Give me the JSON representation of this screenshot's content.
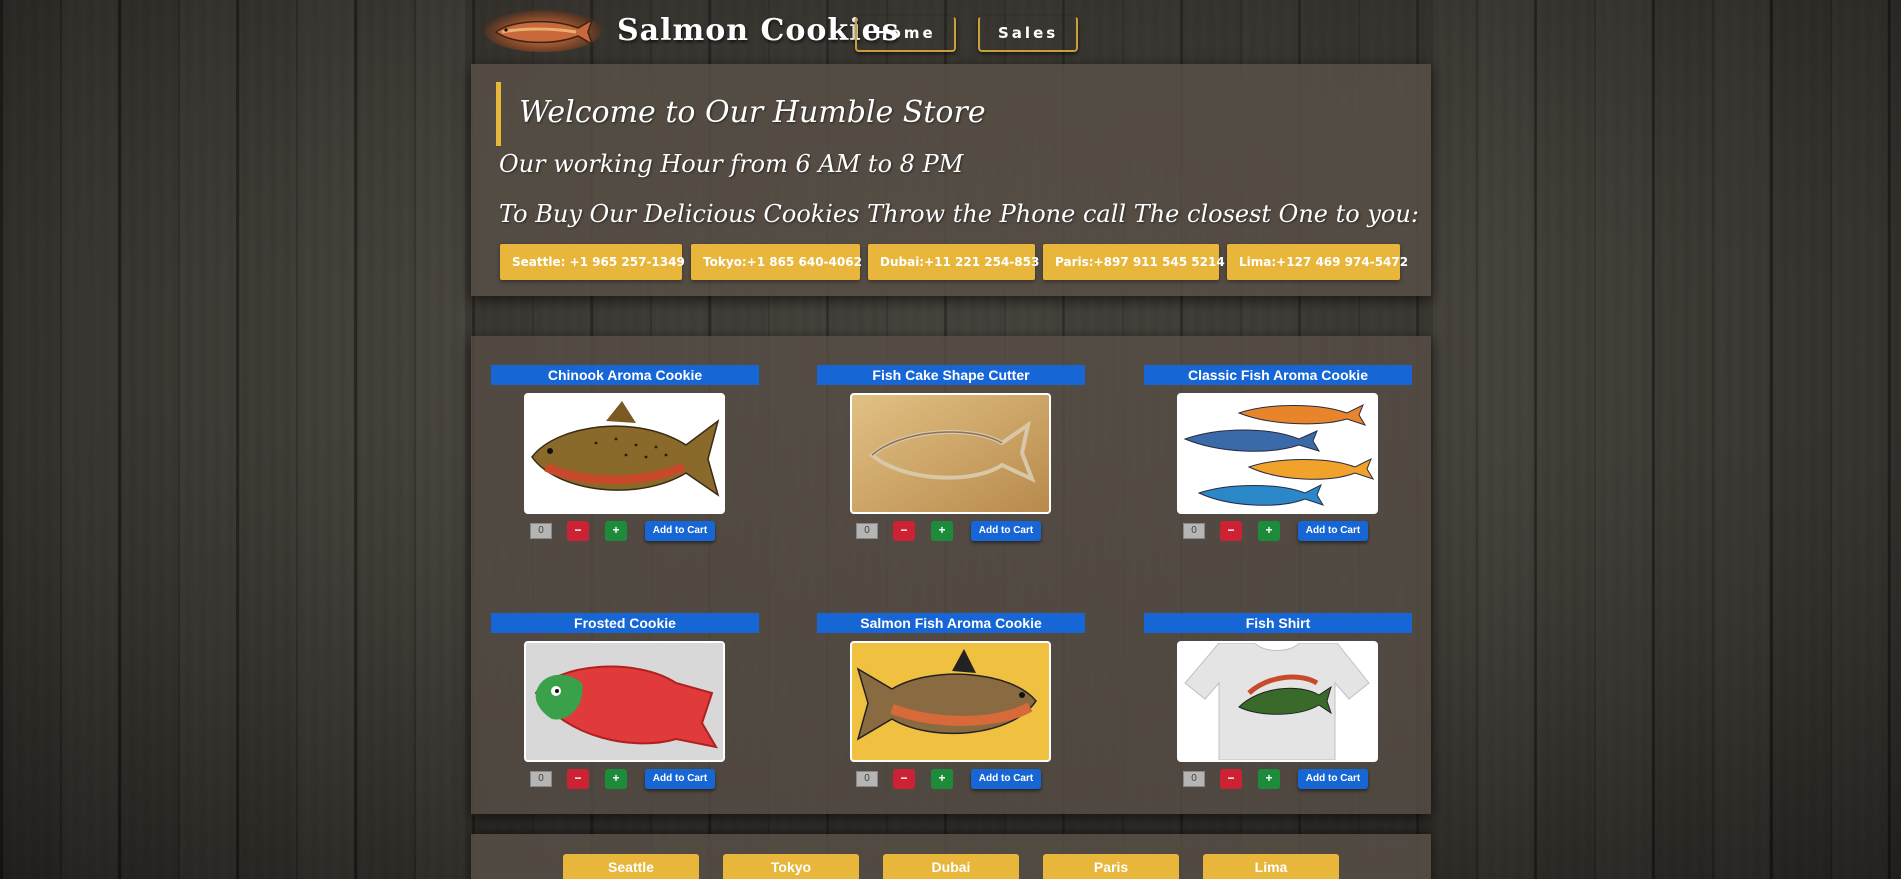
{
  "header": {
    "title": "Salmon Cookies",
    "nav": [
      {
        "label": "Home"
      },
      {
        "label": "Sales"
      }
    ]
  },
  "welcome": {
    "title": "Welcome to Our Humble Store",
    "hours": "Our working Hour from 6 AM to 8 PM",
    "buy_line": "To Buy Our Delicious Cookies Throw the Phone call The closest One to you:",
    "phones": [
      {
        "label": "Seattle: +1 965 257-1349"
      },
      {
        "label": "Tokyo:+1 865 640-4062"
      },
      {
        "label": "Dubai:+11 221 254-853"
      },
      {
        "label": "Paris:+897 911 545 5214"
      },
      {
        "label": "Lima:+127 469 974-5472"
      }
    ]
  },
  "products": [
    {
      "name": "Chinook Aroma Cookie",
      "qty": "0"
    },
    {
      "name": "Fish Cake Shape Cutter",
      "qty": "0"
    },
    {
      "name": "Classic Fish Aroma Cookie",
      "qty": "0"
    },
    {
      "name": "Frosted Cookie",
      "qty": "0"
    },
    {
      "name": "Salmon Fish Aroma Cookie",
      "qty": "0"
    },
    {
      "name": "Fish Shirt",
      "qty": "0"
    }
  ],
  "controls": {
    "minus": "−",
    "plus": "+",
    "add_to_cart": "Add to Cart"
  },
  "footer": {
    "cities": [
      "Seattle",
      "Tokyo",
      "Dubai",
      "Paris",
      "Lima"
    ]
  },
  "colors": {
    "accent_gold": "#e7b63b",
    "primary_blue": "#1766d6",
    "minus_red": "#cc2233",
    "plus_green": "#1d8c3a"
  }
}
